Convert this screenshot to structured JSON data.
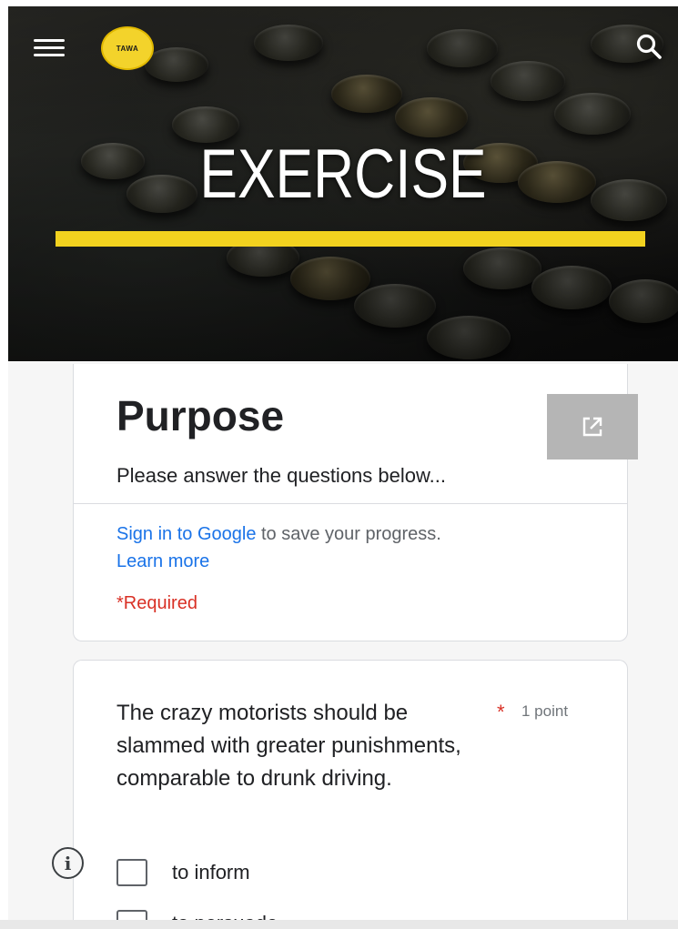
{
  "header": {
    "logo_text": "TAWA",
    "hero_title": "EXERCISE",
    "accent_color": "#f2d21f",
    "icons": [
      "hamburger-menu-icon",
      "search-icon"
    ]
  },
  "form": {
    "title": "Purpose",
    "description": "Please answer the questions below...",
    "signin_link": "Sign in to Google",
    "signin_rest": " to save your progress.",
    "learn_more": "Learn more",
    "required_note": "*Required",
    "open_icon": "open-in-new-icon"
  },
  "question": {
    "text": "The crazy motorists should be slammed with greater punishments, comparable to drunk driving.",
    "required_mark": "*",
    "points": "1 point",
    "options": [
      "to inform",
      "to persuade"
    ]
  },
  "info_icon": "info-icon"
}
